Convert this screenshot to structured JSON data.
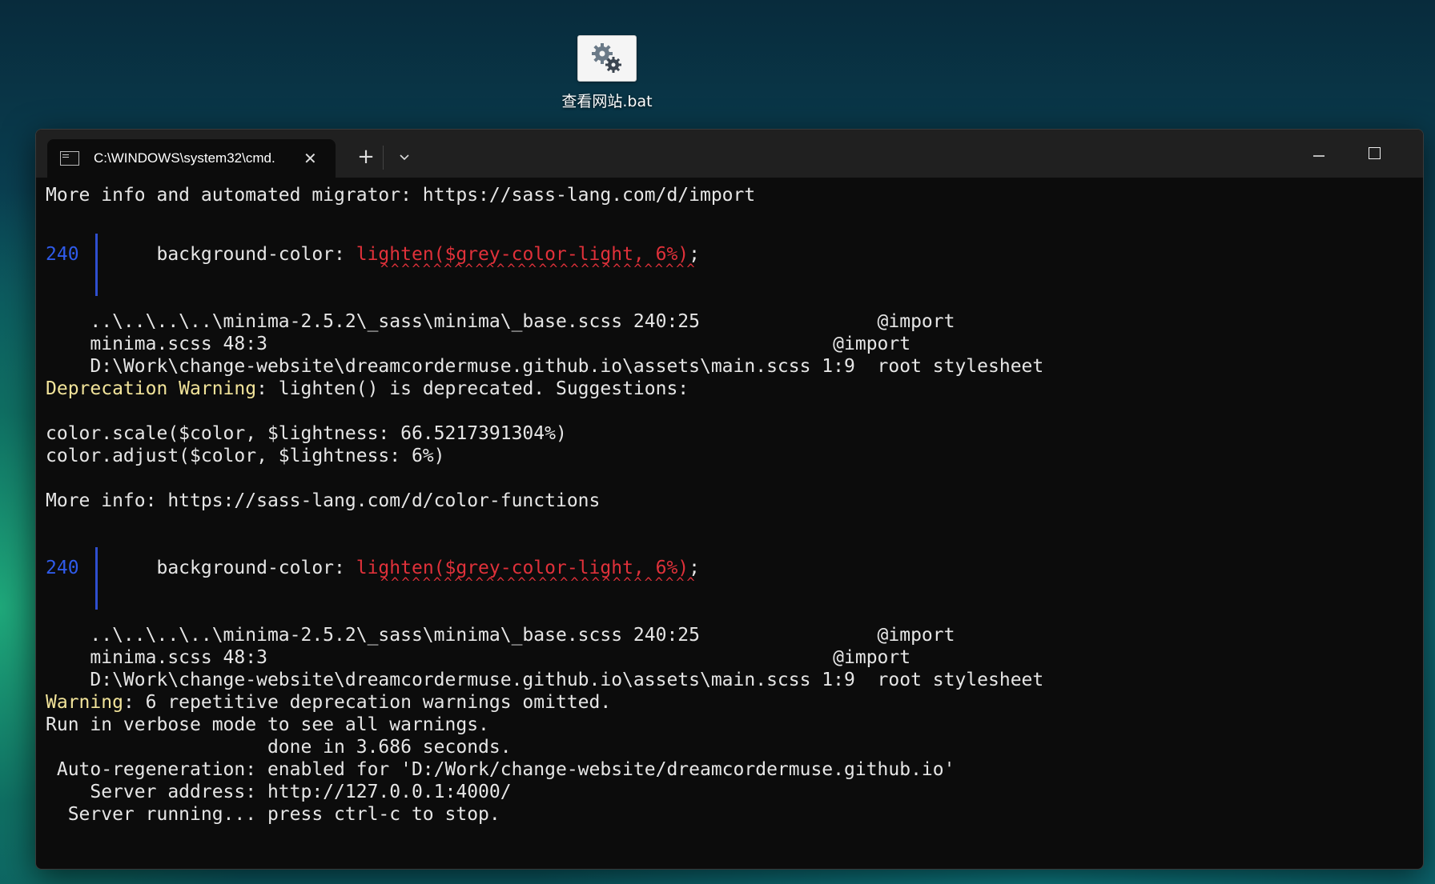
{
  "desktop": {
    "icon_label": "查看网站.bat",
    "icon_name": "gear-icon"
  },
  "window": {
    "tab_title": "C:\\WINDOWS\\system32\\cmd.",
    "tab_close": "✕",
    "new_tab": "+",
    "dropdown": "⌄",
    "minimize": "—",
    "close": "✕"
  },
  "terminal": {
    "l1": "More info and automated migrator: https://sass-lang.com/d/import",
    "block1": {
      "line_no": "240",
      "code_prefix": "       background-color: ",
      "code_highlight": "lighten($grey-color-light, 6%)",
      "code_suffix": ";",
      "carets": "^^^^^^^^^^^^^^^^^^^^^^^^^^^^^^",
      "trace": [
        {
          "path": "    ..\\..\\..\\..\\minima-2.5.2\\_sass\\minima\\_base.scss 240:25                ",
          "kind": "@import"
        },
        {
          "path": "    minima.scss 48:3                                                   ",
          "kind": "@import"
        },
        {
          "path": "    D:\\Work\\change-website\\dreamcordermuse.github.io\\assets\\main.scss 1:9  ",
          "kind": "root stylesheet"
        }
      ]
    },
    "dep_label": "Deprecation Warning",
    "dep_rest": ": lighten() is deprecated. Suggestions:",
    "suggest1": "color.scale($color, $lightness: 66.5217391304%)",
    "suggest2": "color.adjust($color, $lightness: 6%)",
    "more_info": "More info: https://sass-lang.com/d/color-functions",
    "block2": {
      "line_no": "240",
      "code_prefix": "       background-color: ",
      "code_highlight": "lighten($grey-color-light, 6%)",
      "code_suffix": ";",
      "carets": "^^^^^^^^^^^^^^^^^^^^^^^^^^^^^^",
      "trace": [
        {
          "path": "    ..\\..\\..\\..\\minima-2.5.2\\_sass\\minima\\_base.scss 240:25                ",
          "kind": "@import"
        },
        {
          "path": "    minima.scss 48:3                                                   ",
          "kind": "@import"
        },
        {
          "path": "    D:\\Work\\change-website\\dreamcordermuse.github.io\\assets\\main.scss 1:9  ",
          "kind": "root stylesheet"
        }
      ]
    },
    "warn_label": "Warning",
    "warn_rest": ": 6 repetitive deprecation warnings omitted.",
    "verbose": "Run in verbose mode to see all warnings.",
    "done": "                    done in 3.686 seconds.",
    "autoregen": " Auto-regeneration: enabled for 'D:/Work/change-website/dreamcordermuse.github.io'",
    "server_addr": "    Server address: http://127.0.0.1:4000/",
    "server_run": "  Server running... press ctrl-c to stop."
  },
  "colors": {
    "warning_yellow": "#f2e49a",
    "error_red": "#e0313a",
    "line_blue": "#2f5bea",
    "terminal_bg": "#0c0c0c"
  }
}
